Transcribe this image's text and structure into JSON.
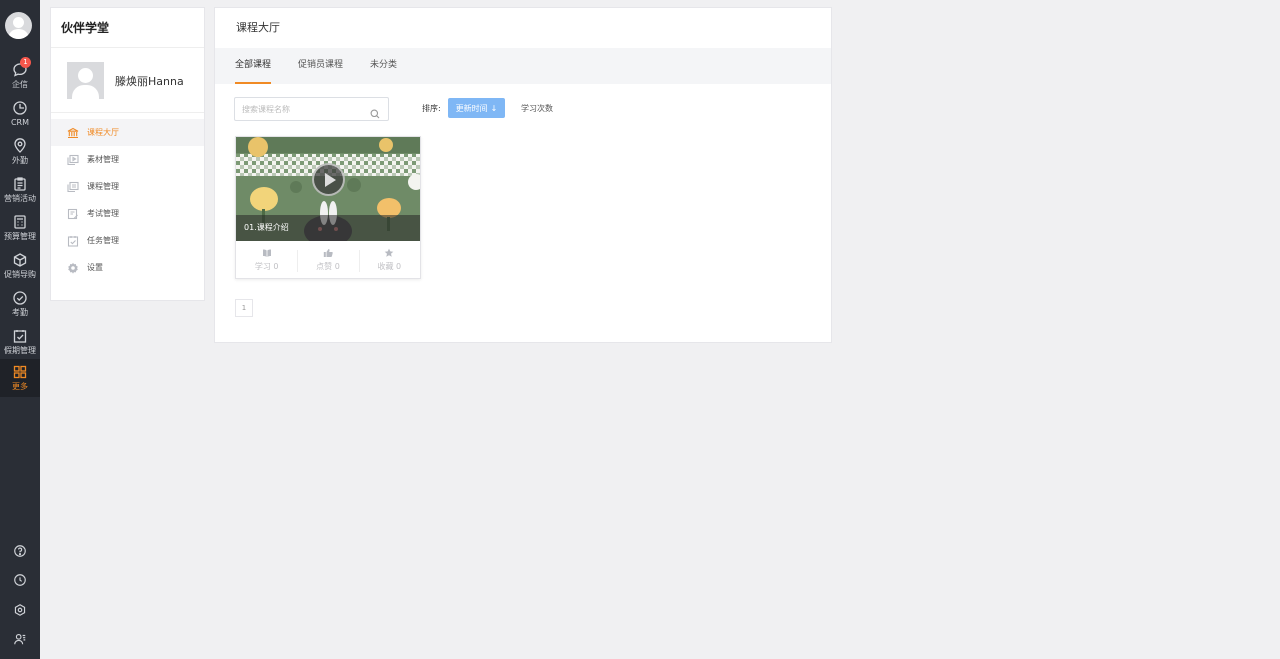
{
  "rail": {
    "items": [
      {
        "label": "企信",
        "icon": "chat-icon",
        "badge": "1"
      },
      {
        "label": "CRM",
        "icon": "clock-pie-icon"
      },
      {
        "label": "外勤",
        "icon": "location-pin-icon"
      },
      {
        "label": "营销活动",
        "icon": "clipboard-icon"
      },
      {
        "label": "预算管理",
        "icon": "calculator-icon"
      },
      {
        "label": "促销导购",
        "icon": "box-icon"
      },
      {
        "label": "考勤",
        "icon": "check-circle-icon"
      },
      {
        "label": "假期管理",
        "icon": "calendar-check-icon"
      },
      {
        "label": "更多",
        "icon": "grid-icon"
      }
    ],
    "bottom": [
      "help-icon",
      "history-icon",
      "settings-icon",
      "contacts-icon"
    ]
  },
  "side": {
    "title": "伙伴学堂",
    "user_name": "滕焕丽Hanna",
    "menu": [
      {
        "label": "课程大厅",
        "icon": "bank-icon"
      },
      {
        "label": "素材管理",
        "icon": "media-icon"
      },
      {
        "label": "课程管理",
        "icon": "course-icon"
      },
      {
        "label": "考试管理",
        "icon": "exam-icon"
      },
      {
        "label": "任务管理",
        "icon": "task-icon"
      },
      {
        "label": "设置",
        "icon": "gear-icon"
      }
    ]
  },
  "main": {
    "title": "课程大厅",
    "tabs": [
      "全部课程",
      "促销员课程",
      "未分类"
    ],
    "search_placeholder": "搜索课程名称",
    "sort_label": "排序:",
    "sort_active": "更新时间",
    "sort_alt": "学习次数",
    "course": {
      "title": "01.课程介绍",
      "stats": [
        {
          "label": "学习 0",
          "icon": "book-icon"
        },
        {
          "label": "点赞 0",
          "icon": "thumbs-up-icon"
        },
        {
          "label": "收藏 0",
          "icon": "star-icon"
        }
      ]
    },
    "page": "1"
  },
  "colors": {
    "accent": "#f08a24",
    "sort_button": "#7fb7f5",
    "rail_bg": "#2a2e36"
  }
}
